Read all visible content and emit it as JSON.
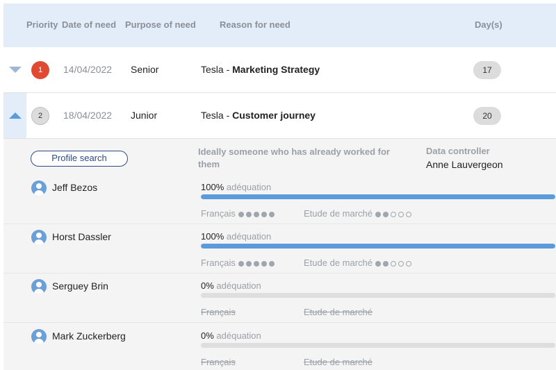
{
  "columns": {
    "priority": "Priority",
    "date": "Date of need",
    "purpose": "Purpose of need",
    "reason": "Reason for need",
    "days": "Day(s)"
  },
  "requests": [
    {
      "priority": "1",
      "date": "14/04/2022",
      "purpose": "Senior",
      "company": "Tesla",
      "separator": " - ",
      "topic": "Marketing Strategy",
      "days": "17",
      "expanded": false
    },
    {
      "priority": "2",
      "date": "18/04/2022",
      "purpose": "Junior",
      "company": "Tesla",
      "separator": " - ",
      "topic": "Customer journey",
      "days": "20",
      "expanded": true
    }
  ],
  "details": {
    "profile_search_label": "Profile search",
    "ideal_text": "Ideally someone who has already worked for them",
    "data_controller_label": "Data controller",
    "data_controller_name": "Anne Lauvergeon"
  },
  "match_label": "adéquation",
  "candidates": [
    {
      "name": "Jeff Bezos",
      "match_pct": "100%",
      "match_fraction": 1.0,
      "skills": [
        {
          "label": "Français",
          "level": 5,
          "max": 5
        },
        {
          "label": "Etude de marché",
          "level": 2,
          "max": 5
        }
      ]
    },
    {
      "name": "Horst Dassler",
      "match_pct": "100%",
      "match_fraction": 1.0,
      "skills": [
        {
          "label": "Français",
          "level": 5,
          "max": 5
        },
        {
          "label": "Etude de marché",
          "level": 2,
          "max": 5
        }
      ]
    },
    {
      "name": "Serguey Brin",
      "match_pct": "0%",
      "match_fraction": 0.0,
      "skills": [
        {
          "label": "Français",
          "level": 0,
          "max": 0
        },
        {
          "label": "Etude de marché",
          "level": 0,
          "max": 0
        }
      ]
    },
    {
      "name": "Mark Zuckerberg",
      "match_pct": "0%",
      "match_fraction": 0.0,
      "skills": [
        {
          "label": "Français",
          "level": 0,
          "max": 0
        },
        {
          "label": "Etude de marché",
          "level": 0,
          "max": 0
        }
      ]
    }
  ],
  "colors": {
    "header_bg": "#e3edf9",
    "priority_high": "#e04a33",
    "bar_fill": "#5b9bdc",
    "button_border": "#2e4a86"
  }
}
